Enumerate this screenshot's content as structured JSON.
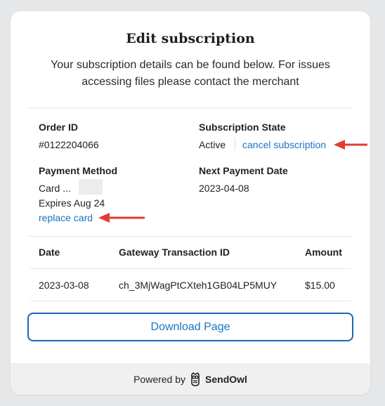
{
  "page": {
    "title": "Edit subscription",
    "subtitle": "Your subscription details can be found below. For issues accessing files please contact the merchant"
  },
  "order": {
    "label": "Order ID",
    "value": "#0122204066"
  },
  "state": {
    "label": "Subscription State",
    "value": "Active",
    "cancel_link": "cancel subscription"
  },
  "payment": {
    "label": "Payment Method",
    "card_prefix": "Card ...",
    "expires": "Expires Aug 24",
    "replace_link": "replace card"
  },
  "next_payment": {
    "label": "Next Payment Date",
    "value": "2023-04-08"
  },
  "table": {
    "columns": [
      "Date",
      "Gateway Transaction ID",
      "Amount"
    ],
    "rows": [
      [
        "2023-03-08",
        "ch_3MjWagPtCXteh1GB04LP5MUY",
        "$15.00"
      ]
    ]
  },
  "download_button": "Download Page",
  "footer": {
    "powered_by": "Powered by",
    "brand": "SendOwl"
  },
  "colors": {
    "accent": "#1a73c4",
    "button_border": "#1a67b8",
    "arrow": "#e53935",
    "footer_bg": "#f0f0f0"
  },
  "icons": {
    "brand_logo": "sendowl-owl-icon",
    "annotation": "red-arrow-icon"
  }
}
